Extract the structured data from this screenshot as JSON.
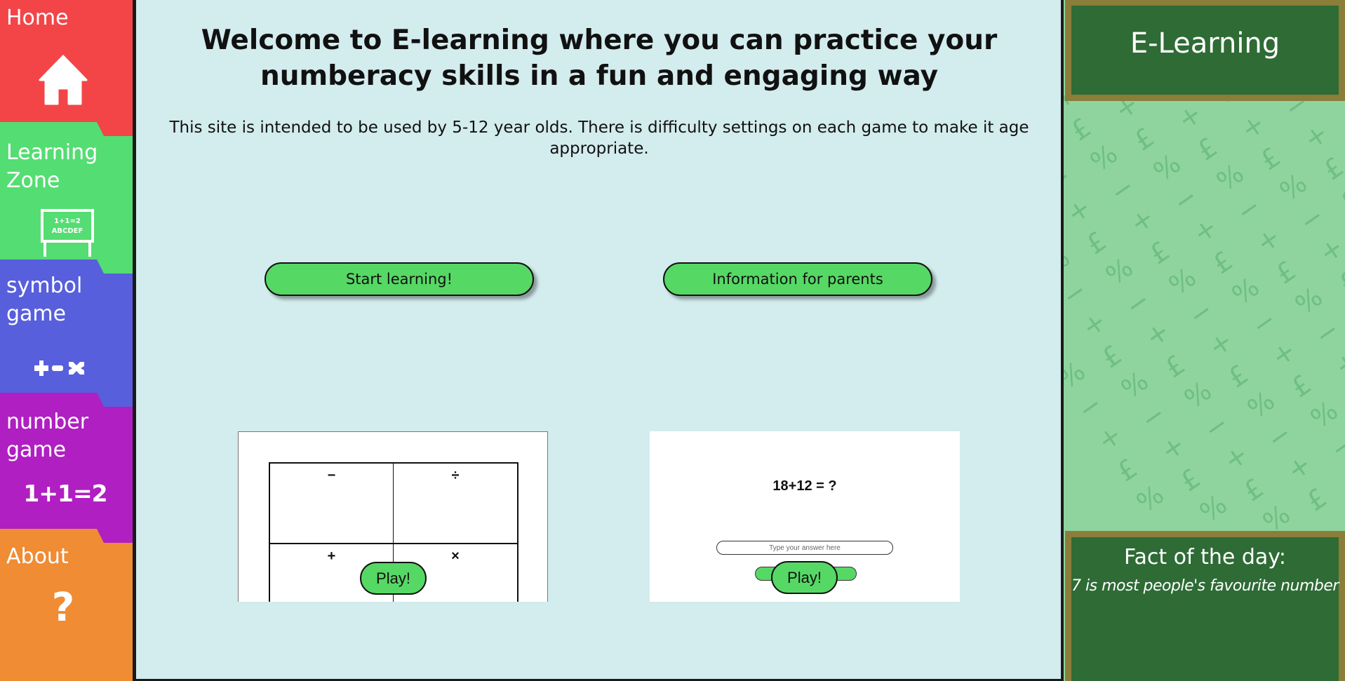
{
  "nav": {
    "items": [
      {
        "label_lines": [
          "Home"
        ],
        "icon": "house-icon",
        "color": "#f34548"
      },
      {
        "label_lines": [
          "Learning",
          "Zone"
        ],
        "icon": "whiteboard-icon",
        "icon_text": [
          "1+1=2",
          "ABCDEF"
        ],
        "color": "#54dd72"
      },
      {
        "label_lines": [
          "symbol",
          "game"
        ],
        "icon": "plus-minus-times-icon",
        "color": "#575fdc"
      },
      {
        "label_lines": [
          "number",
          "game"
        ],
        "icon": "one-plus-one-icon",
        "icon_text": "1+1=2",
        "color": "#b01fc1"
      },
      {
        "label_lines": [
          "About"
        ],
        "icon": "question-mark-icon",
        "icon_text": "?",
        "color": "#ef8c34"
      }
    ]
  },
  "main": {
    "title": "Welcome to E-learning where you can practice your numberacy skills in a fun and engaging way",
    "description": "This site is intended to be used by 5-12 year olds. There is difficulty settings on each game to make it age appropriate.",
    "buttons": {
      "start": "Start learning!",
      "parents": "Information for parents"
    },
    "symbol_preview": {
      "symbols": [
        "−",
        "÷",
        "+",
        "×"
      ],
      "play": "Play!"
    },
    "number_preview": {
      "question": "18+12 = ?",
      "answer_placeholder": "Type your answer here",
      "play": "Play!"
    },
    "background": "#d3ecee",
    "accent": "#56d865"
  },
  "right": {
    "brand": "E-Learning",
    "fact_heading": "Fact of the day:",
    "fact_text": "7 is most people's favourite number",
    "pattern_glyphs": [
      "£",
      "+",
      "−",
      "%"
    ],
    "board_color": "#2e6b35",
    "frame_color": "#8b7d3a",
    "pattern_bg": "#8fd49f"
  }
}
